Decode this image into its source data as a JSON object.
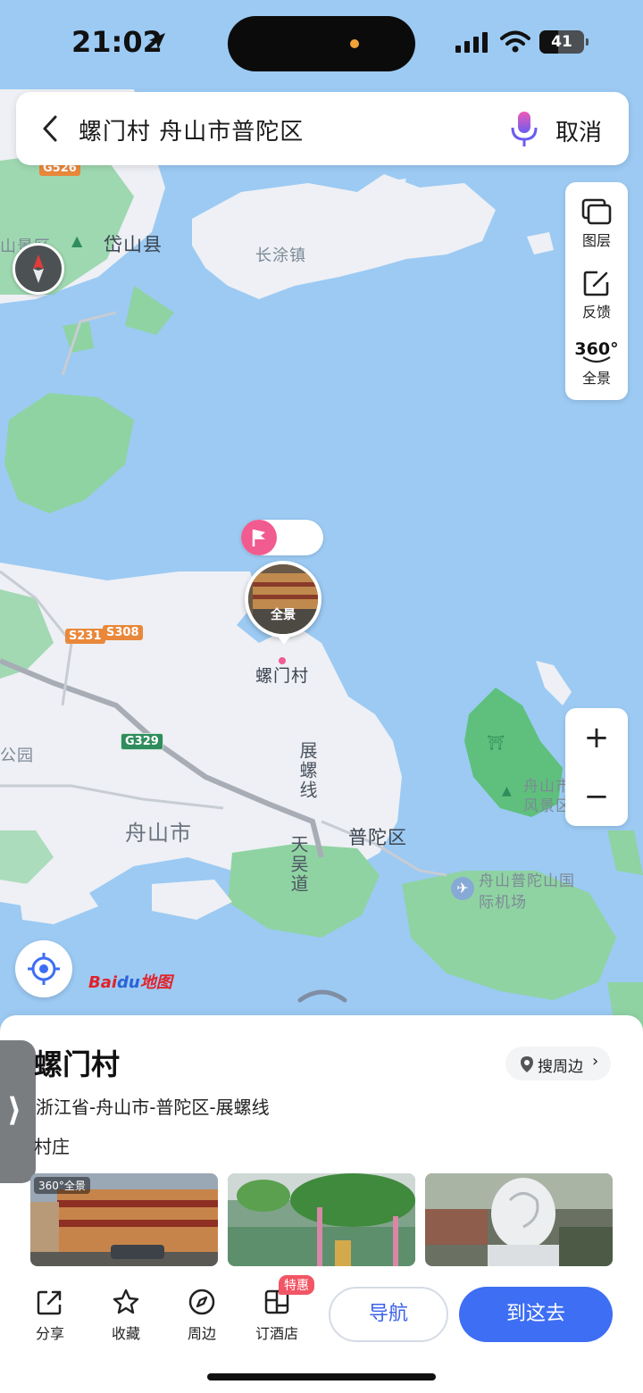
{
  "status_bar": {
    "time": "21:02",
    "battery": "41",
    "battery_level": 0.41
  },
  "search": {
    "query": "螺门村 舟山市普陀区",
    "cancel_label": "取消"
  },
  "map_tools": [
    {
      "label": "图层",
      "icon": "layers-icon"
    },
    {
      "label": "反馈",
      "icon": "feedback-icon"
    },
    {
      "label": "全景",
      "icon": "panorama-360-icon",
      "badge": "360°"
    }
  ],
  "zoom": {
    "in_label": "+",
    "out_label": "−"
  },
  "map_labels": {
    "daishan_area": "山景区",
    "daishan_county": "岱山县",
    "changtu_town": "长涂镇",
    "luomen_village": "螺门村",
    "park": "公园",
    "zhan_luo_road": "展螺线",
    "zhoushan_city": "舟山市",
    "putuo_district": "普陀区",
    "tianwu_road": "天吴道",
    "putuo_airport": "舟山普陀山国际机场",
    "scenic_spot": "舟山市风景区"
  },
  "road_shields": [
    {
      "code": "G526",
      "color": "#e9883a"
    },
    {
      "code": "S231",
      "color": "#e9883a"
    },
    {
      "code": "S308",
      "color": "#e9883a"
    },
    {
      "code": "G329",
      "color": "#2f8d5d"
    }
  ],
  "marker": {
    "pano_label": "全景"
  },
  "brand": {
    "text_red": "Bai",
    "text_blue": "du",
    "text_tail": "地图"
  },
  "place": {
    "title": "螺门村",
    "nearby_label": "搜周边",
    "address": "浙江省-舟山市-普陀区-展螺线",
    "category": "村庄",
    "photo_badge": "360°全景"
  },
  "actions": [
    {
      "label": "分享",
      "icon": "share-icon"
    },
    {
      "label": "收藏",
      "icon": "star-icon"
    },
    {
      "label": "周边",
      "icon": "compass-icon"
    },
    {
      "label": "订酒店",
      "icon": "hotel-icon",
      "badge": "特惠"
    }
  ],
  "buttons": {
    "navigate": "导航",
    "go_there": "到这去"
  },
  "colors": {
    "water": "#9ccaf3",
    "land": "#eef0f5",
    "green": "#8fd3a3",
    "accent": "#3d6ef4",
    "pink": "#f15b8f"
  }
}
